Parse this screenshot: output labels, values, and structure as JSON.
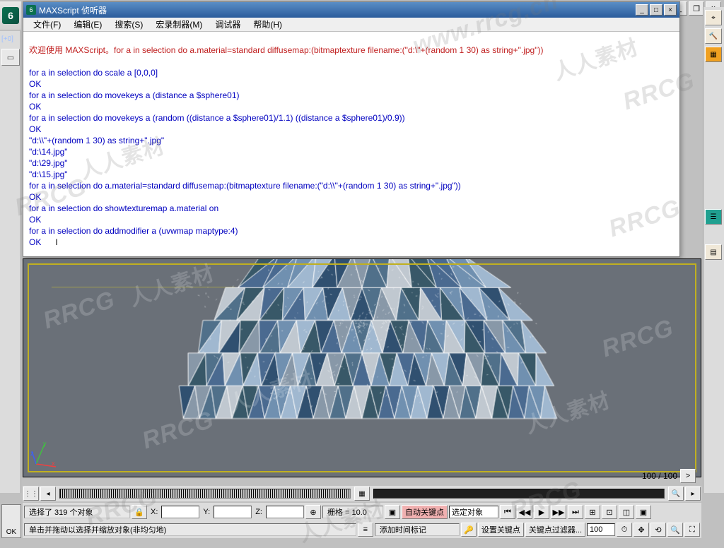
{
  "window": {
    "title": "MAXScript 侦听器",
    "minimize": "_",
    "maximize": "□",
    "close": "×"
  },
  "menu": {
    "file": "文件(F)",
    "edit": "编辑(E)",
    "search": "搜索(S)",
    "macro": "宏录制器(M)",
    "debug": "调试器",
    "help": "帮助(H)"
  },
  "listener": {
    "l1": "欢迎使用 MAXScript。for a in selection do a.material=standard diffusemap:(bitmaptexture filename:(\"d:\\\"+(random 1 30) as string+\".jpg\"))",
    "l2": "",
    "l3": "for a in selection do scale a [0,0,0]",
    "l4": "OK",
    "l5": "for a in selection do movekeys a (distance a $sphere01)",
    "l6": "OK",
    "l7": "for a in selection do movekeys a (random ((distance a $sphere01)/1.1) ((distance a $sphere01)/0.9))",
    "l8": "OK",
    "l9": "\"d:\\\\\"+(random 1 30) as string+\".jpg\"",
    "l10": "\"d:\\14.jpg\"",
    "l11": "\"d:\\29.jpg\"",
    "l12": "\"d:\\15.jpg\"",
    "l13": "for a in selection do a.material=standard diffusemap:(bitmaptexture filename:(\"d:\\\\\"+(random 1 30) as string+\".jpg\"))",
    "l14": "OK",
    "l15": "for a in selection do showtexturemap a.material on",
    "l16": "OK",
    "l17": "for a in selection do addmodifier a (uvwmap maptype:4)",
    "l18": "OK"
  },
  "timeline": {
    "frame_display": "100 / 100",
    "scrub_right": ">"
  },
  "status": {
    "selection_info": "选择了 319 个对象",
    "prompt": "单击并拖动以选择并缩放对象(非均匀地)",
    "x_label": "X:",
    "y_label": "Y:",
    "z_label": "Z:",
    "grid_label": "栅格 = 10.0",
    "autokey": "自动关键点",
    "selected_obj": "选定对象",
    "setkey": "设置关键点",
    "keyfilter": "关键点过滤器...",
    "add_time_tag": "添加时间标记",
    "frame_field": "100",
    "lock_icon": "🔒",
    "ok_label": "OK"
  },
  "parent_controls": {
    "minimize": "_",
    "restore": "❐",
    "close": "×"
  },
  "watermark": {
    "en": "RRCG",
    "cn": "人人素材",
    "url": "www.rrcg.cn"
  }
}
